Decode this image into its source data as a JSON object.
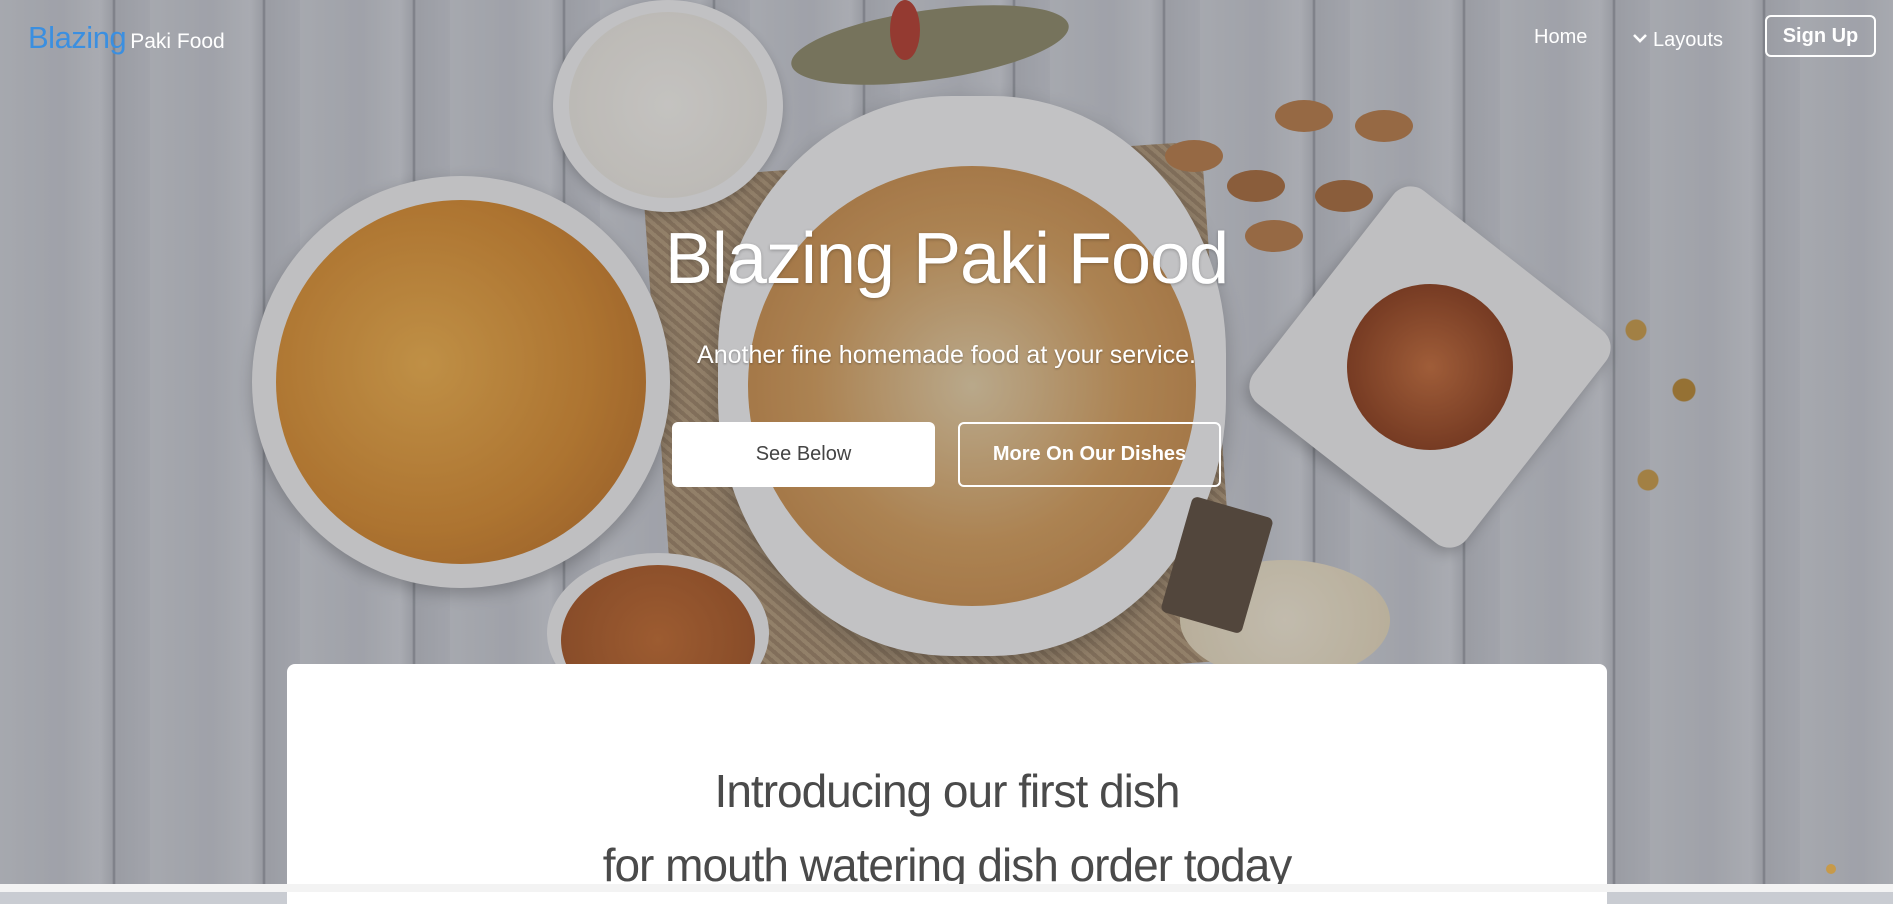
{
  "nav": {
    "brand_primary": "Blazing",
    "brand_secondary": "Paki Food",
    "home": "Home",
    "layouts": "Layouts",
    "signup": "Sign Up"
  },
  "hero": {
    "title": "Blazing Paki Food",
    "subtitle": "Another fine homemade food at your service.",
    "btn_primary": "See Below",
    "btn_secondary": "More On Our Dishes"
  },
  "intro": {
    "line1": "Introducing our first dish",
    "line2": "for mouth watering dish order today"
  },
  "colors": {
    "brand_blue": "#3b8fe0",
    "text_white": "#ffffff",
    "card_bg": "#ffffff"
  }
}
